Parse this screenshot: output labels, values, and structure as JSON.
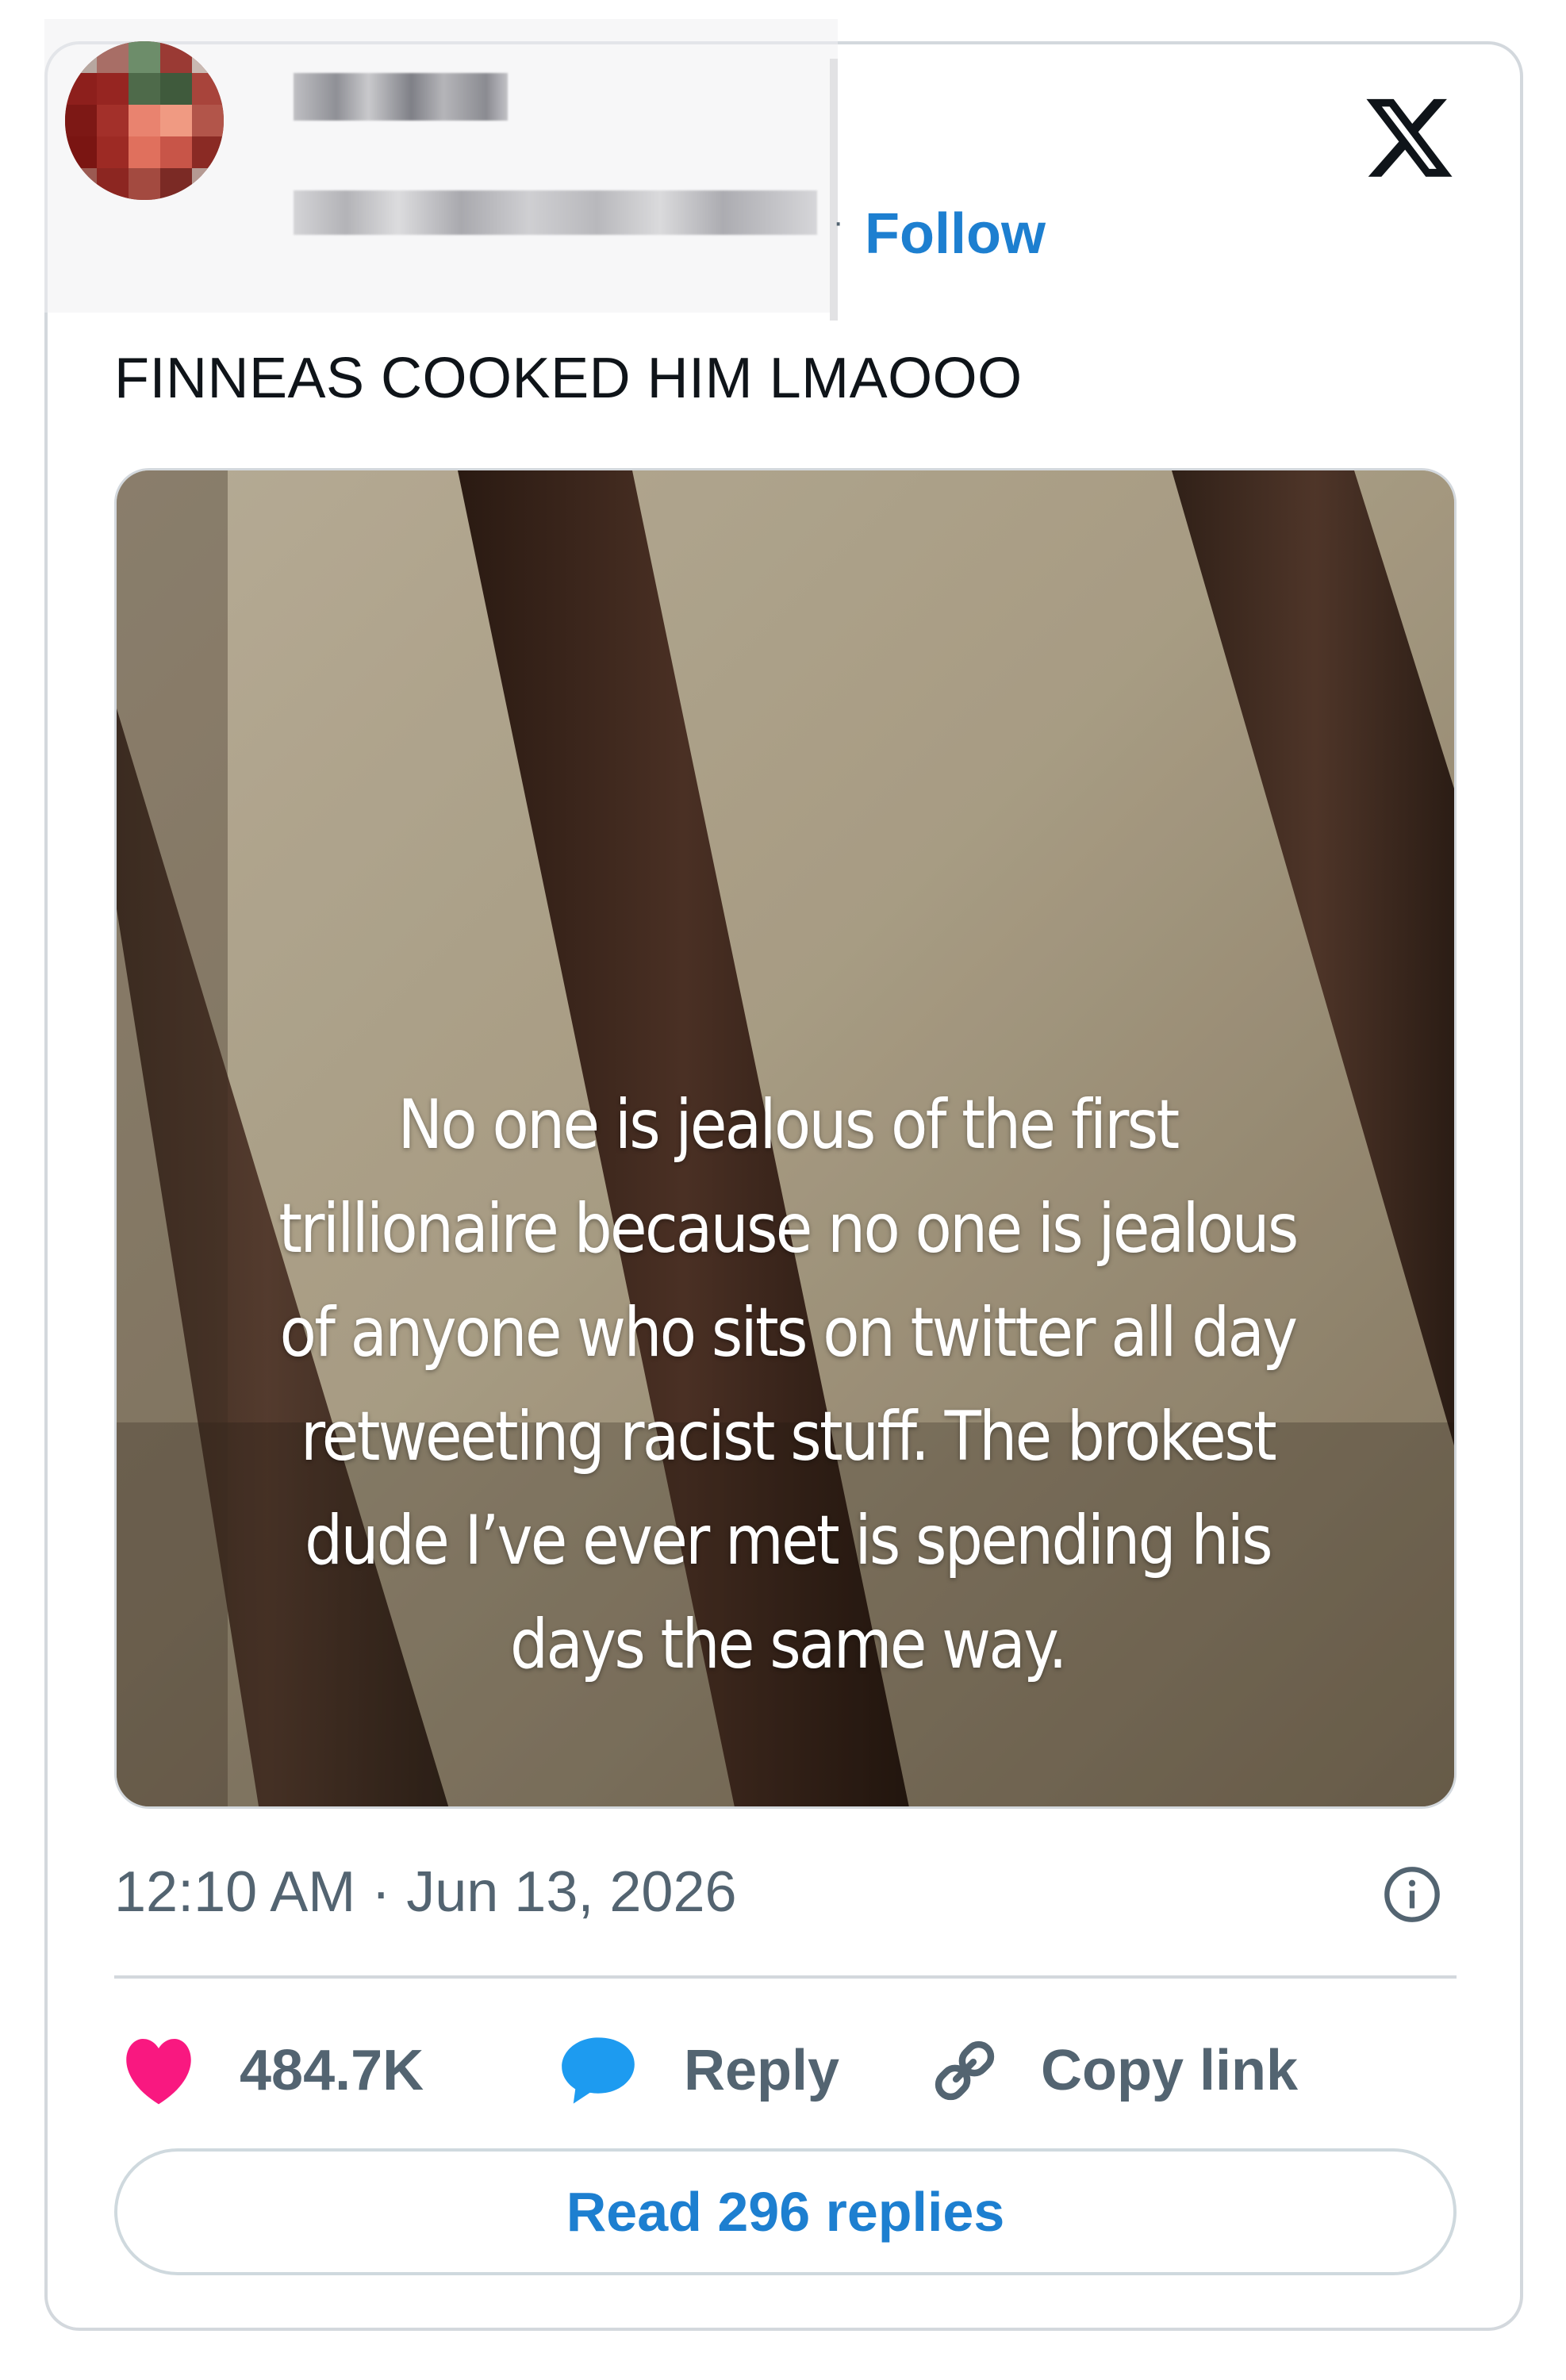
{
  "header": {
    "follow_label": "Follow",
    "separator": "·"
  },
  "tweet": {
    "text": "FINNEAS COOKED HIM LMAOOO",
    "media_caption": "No one is jealous of the first trillionaire because no one is jealous of anyone who sits on twitter all day retweeting racist stuff. The brokest dude I’ve ever met is spending his days the same way.",
    "timestamp": "12:10 AM · Jun 13, 2026"
  },
  "actions": {
    "like_count": "484.7K",
    "reply_label": "Reply",
    "copy_link_label": "Copy link",
    "read_replies_label": "Read 296 replies"
  },
  "colors": {
    "link_blue": "#1d7fd0",
    "heart_pink": "#f91880",
    "reply_blue": "#1d9bf0",
    "muted_gray": "#536471",
    "text_black": "#0f1419",
    "border_gray": "#d3d8dd"
  },
  "icons": {
    "logo": "x-logo-icon",
    "info": "info-icon",
    "like": "heart-icon",
    "reply": "speech-bubble-icon",
    "copy": "link-icon"
  }
}
